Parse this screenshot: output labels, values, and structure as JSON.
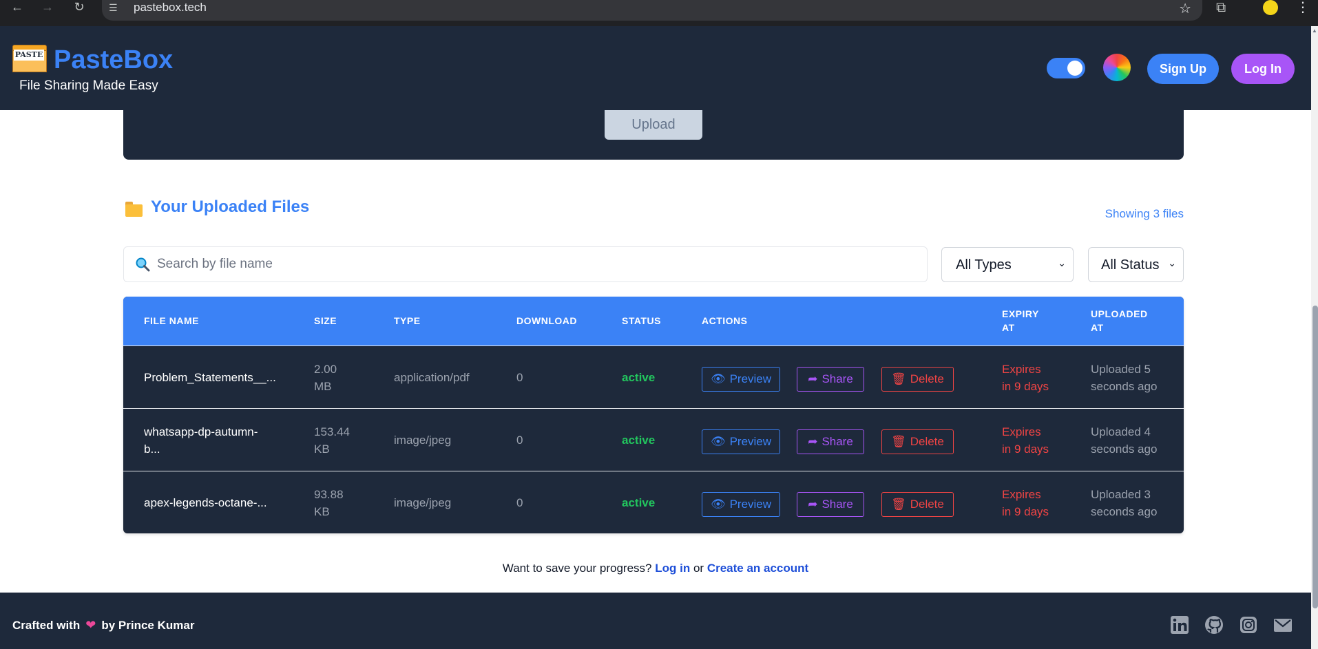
{
  "browser": {
    "url": "pastebox.tech"
  },
  "header": {
    "logo_label": "PASTE",
    "brand": "PasteBox",
    "tagline": "File Sharing Made Easy",
    "signup_label": "Sign Up",
    "login_label": "Log In",
    "accent_color": "#3b82f6",
    "login_color": "#a855f7"
  },
  "upload": {
    "button_label": "Upload"
  },
  "files": {
    "title": "Your Uploaded Files",
    "count_text": "Showing 3 files",
    "search_placeholder": "Search by file name",
    "type_filter": "All Types",
    "status_filter": "All Status",
    "columns": {
      "name": "FILE NAME",
      "size": "SIZE",
      "type": "TYPE",
      "download": "DOWNLOAD",
      "status": "STATUS",
      "actions": "ACTIONS",
      "expiry_1": "EXPIRY",
      "expiry_2": "AT",
      "uploaded_1": "UPLOADED",
      "uploaded_2": "AT"
    },
    "rows": [
      {
        "name_1": "Problem_Statements__...",
        "name_2": "",
        "size_1": "2.00",
        "size_2": "MB",
        "type": "application/pdf",
        "downloads": "0",
        "status": "active",
        "expiry_1": "Expires",
        "expiry_2": "in 9 days",
        "uploaded_1": "Uploaded 5",
        "uploaded_2": "seconds ago"
      },
      {
        "name_1": "whatsapp-dp-autumn-",
        "name_2": "b...",
        "size_1": "153.44",
        "size_2": "KB",
        "type": "image/jpeg",
        "downloads": "0",
        "status": "active",
        "expiry_1": "Expires",
        "expiry_2": "in 9 days",
        "uploaded_1": "Uploaded 4",
        "uploaded_2": "seconds ago"
      },
      {
        "name_1": "apex-legends-octane-...",
        "name_2": "",
        "size_1": "93.88",
        "size_2": "KB",
        "type": "image/jpeg",
        "downloads": "0",
        "status": "active",
        "expiry_1": "Expires",
        "expiry_2": "in 9 days",
        "uploaded_1": "Uploaded 3",
        "uploaded_2": "seconds ago"
      }
    ],
    "actions": {
      "preview": "Preview",
      "share": "Share",
      "delete": "Delete"
    }
  },
  "save_prompt": {
    "text": "Want to save your progress?",
    "login_link": "Log in",
    "or": "or",
    "create_link": "Create an account"
  },
  "footer": {
    "credit_prefix": "Crafted with",
    "credit_suffix": "by Prince Kumar",
    "icons": [
      "linkedin-icon",
      "github-icon",
      "instagram-icon",
      "mail-icon"
    ]
  }
}
